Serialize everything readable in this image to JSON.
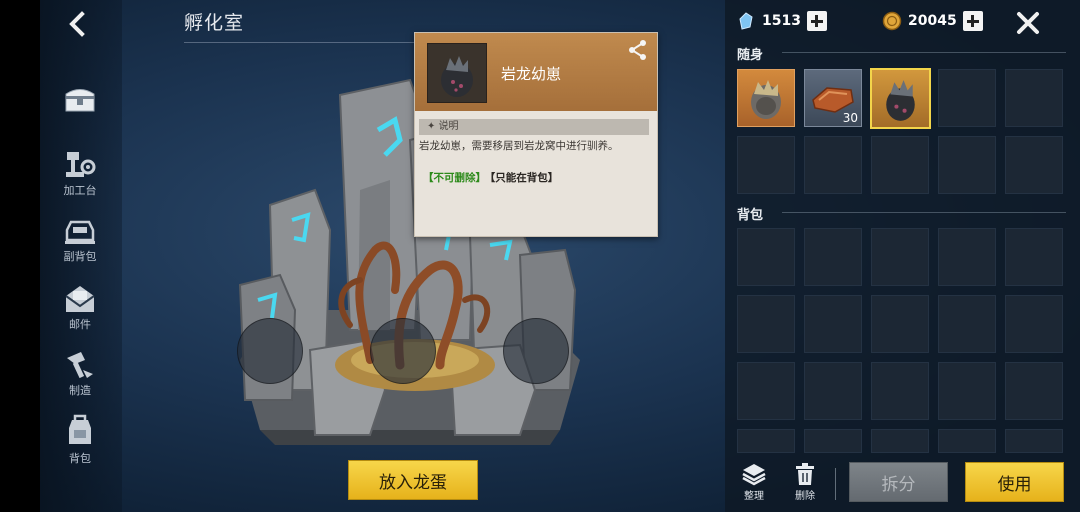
{
  "page": {
    "title": "孵化室"
  },
  "sidebar": {
    "items": [
      {
        "key": "chest",
        "label": ""
      },
      {
        "key": "workbench",
        "label": "加工台"
      },
      {
        "key": "sub-backpack",
        "label": "副背包"
      },
      {
        "key": "mail",
        "label": "邮件"
      },
      {
        "key": "craft",
        "label": "制造"
      },
      {
        "key": "backpack",
        "label": "背包"
      }
    ]
  },
  "incubator": {
    "button_label": "放入龙蛋",
    "slot_count": 3
  },
  "tooltip": {
    "item_name": "岩龙幼崽",
    "section_label": "说明",
    "description": "岩龙幼崽，需要移居到岩龙窝中进行驯养。",
    "tag_1": "【不可删除】",
    "tag_2": "【只能在背包】"
  },
  "resources": {
    "crystal": {
      "value": "1513",
      "icon": "crystal-icon"
    },
    "coin": {
      "value": "20045",
      "icon": "coin-icon"
    }
  },
  "inventory": {
    "carry_label": "随身",
    "backpack_label": "背包",
    "carry_slots": [
      {
        "item": "rock-dragon-egg",
        "count": ""
      },
      {
        "item": "meat-slab",
        "count": "30"
      },
      {
        "item": "rock-dragon-baby",
        "count": "",
        "selected": true
      },
      {
        "item": "",
        "count": ""
      },
      {
        "item": "",
        "count": ""
      },
      {
        "item": "",
        "count": ""
      },
      {
        "item": "",
        "count": ""
      },
      {
        "item": "",
        "count": ""
      },
      {
        "item": "",
        "count": ""
      },
      {
        "item": "",
        "count": ""
      }
    ]
  },
  "toolbar": {
    "sort_label": "整理",
    "delete_label": "删除",
    "split_label": "拆分",
    "use_label": "使用"
  },
  "colors": {
    "accent_yellow": "#f2c832",
    "selected_border": "#f3d54a",
    "rune_glow": "#4ad8f0"
  }
}
